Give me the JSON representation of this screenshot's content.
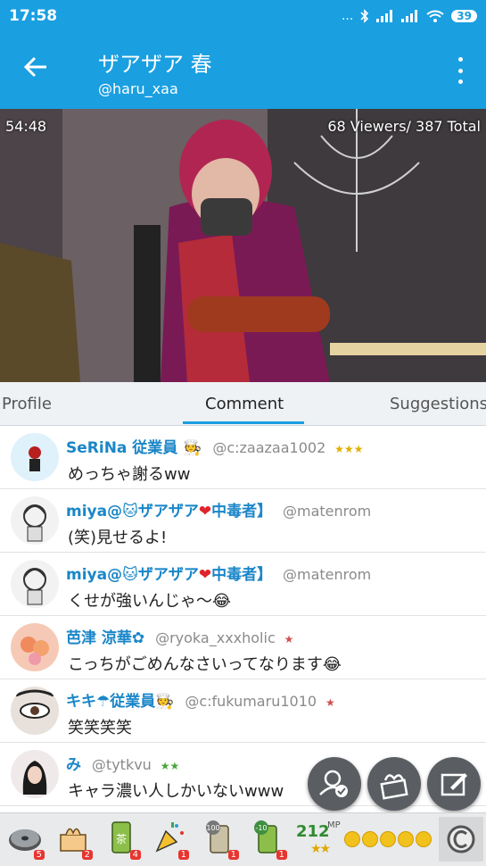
{
  "status_bar": {
    "time": "17:58",
    "signal_dots": "...",
    "battery": "39"
  },
  "header": {
    "title": "ザアザア 春",
    "handle": "@haru_xaa"
  },
  "video": {
    "elapsed": "54:48",
    "viewers": "68 Viewers/ 387 Total"
  },
  "tabs": [
    {
      "label": "Profile"
    },
    {
      "label": "Comment"
    },
    {
      "label": "Suggestions"
    }
  ],
  "comments": [
    {
      "name": "SeRiNa 従業員",
      "user": "@c:zaazaa1002",
      "text": "めっちゃ謝るww"
    },
    {
      "name": "miya@",
      "name2": "ザアザア",
      "name3": "中毒者】",
      "user": "@matenrom",
      "text": "(笑)見せるよ!"
    },
    {
      "name": "miya@",
      "name2": "ザアザア",
      "name3": "中毒者】",
      "user": "@matenrom",
      "text": "くせが強いんじゃ〜"
    },
    {
      "name": "芭津 涼華",
      "user": "@ryoka_xxxholic",
      "text": "こっちがごめんなさいってなります"
    },
    {
      "name": "キキ",
      "name2": "従業員",
      "user": "@c:fukumaru1010",
      "text": "笑笑笑笑"
    },
    {
      "name": "み",
      "user": "@tytkvu",
      "text": "キャラ濃い人しかいないwww"
    }
  ],
  "items": [
    {
      "name": "disc",
      "count": "5"
    },
    {
      "name": "gift-box",
      "count": "2"
    },
    {
      "name": "tea-can",
      "label": "茶",
      "count": "4"
    },
    {
      "name": "party-popper",
      "count": "1"
    },
    {
      "name": "tea-can-100",
      "label": "100",
      "count": "1"
    },
    {
      "name": "tea-can-10",
      "label": "-10",
      "count": "1"
    }
  ],
  "mp": {
    "value": "212",
    "label": "MP"
  },
  "colors": {
    "primary": "#1a9fe0",
    "name": "#1a86c8",
    "fab": "#5a5e63"
  }
}
